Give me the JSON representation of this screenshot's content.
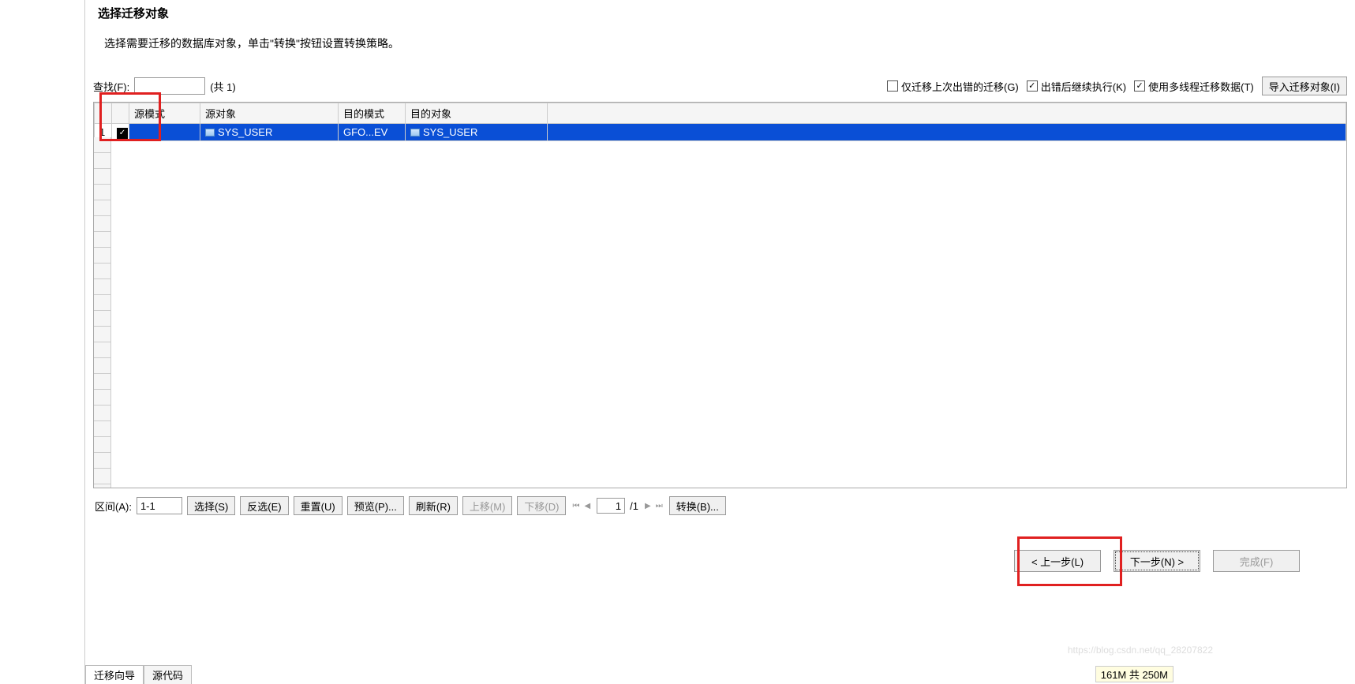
{
  "header": {
    "title": "选择迁移对象",
    "subtitle": "选择需要迁移的数据库对象，单击\"转换\"按钮设置转换策略。"
  },
  "toolbar": {
    "find_label": "查找(F):",
    "find_value": "",
    "count_text": "(共 1)",
    "chk_only_error": "仅迁移上次出错的迁移(G)",
    "chk_continue_on_error": "出错后继续执行(K)",
    "chk_multithread": "使用多线程迁移数据(T)",
    "import_button": "导入迁移对象(I)"
  },
  "table": {
    "headers": {
      "src_schema": "源模式",
      "src_object": "源对象",
      "dst_schema": "目的模式",
      "dst_object": "目的对象"
    },
    "row": {
      "num": "1",
      "src_schema": "",
      "src_object": "SYS_USER",
      "dst_schema": "GFO...EV",
      "dst_object": "SYS_USER"
    }
  },
  "bottom": {
    "range_label": "区间(A):",
    "range_value": "1-1",
    "select_btn": "选择(S)",
    "inverse_btn": "反选(E)",
    "reset_btn": "重置(U)",
    "preview_btn": "预览(P)...",
    "refresh_btn": "刷新(R)",
    "move_up_btn": "上移(M)",
    "move_down_btn": "下移(D)",
    "page_value": "1",
    "page_total": "/1",
    "transform_btn": "转换(B)..."
  },
  "wizard": {
    "prev": "< 上一步(L)",
    "next": "下一步(N) >",
    "finish": "完成(F)"
  },
  "tabs": {
    "wizard": "迁移向导",
    "source": "源代码"
  },
  "status": {
    "memory": "161M 共 250M"
  }
}
